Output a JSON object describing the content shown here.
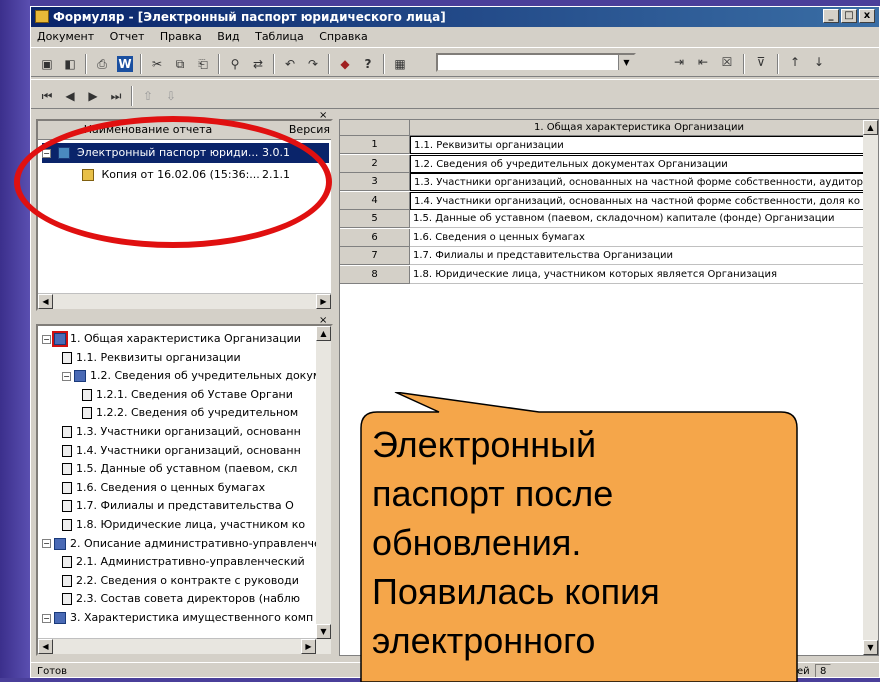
{
  "window": {
    "title": "Формуляр - [Электронный паспорт юридического лица]",
    "controls": [
      "_",
      "□",
      "x"
    ]
  },
  "menu": [
    "Документ",
    "Отчет",
    "Правка",
    "Вид",
    "Таблица",
    "Справка"
  ],
  "reports_panel": {
    "col_name": "Наименование отчета",
    "col_version": "Версия",
    "rows": [
      {
        "name": "Электронный паспорт юриди...",
        "version": "3.0.1",
        "selected": true
      },
      {
        "name": "Копия от 16.02.06 (15:36:...",
        "version": "2.1.1",
        "selected": false
      }
    ]
  },
  "grid": {
    "header": "1. Общая характеристика Организации",
    "rows": [
      {
        "num": "1",
        "text": "1.1. Реквизиты организации"
      },
      {
        "num": "2",
        "text": "1.2. Сведения об учредительных документах Организации"
      },
      {
        "num": "3",
        "text": "1.3. Участники организаций, основанных на частной форме собственности, аудитор"
      },
      {
        "num": "4",
        "text": "1.4. Участники организаций, основанных на частной форме собственности, доля ко"
      },
      {
        "num": "5",
        "text": "1.5. Данные об уставном (паевом, складочном) капитале (фонде) Организации"
      },
      {
        "num": "6",
        "text": "1.6. Сведения о ценных бумагах"
      },
      {
        "num": "7",
        "text": "1.7. Филиалы и представительства Организации"
      },
      {
        "num": "8",
        "text": "1.8. Юридические лица, участником которых является Организация"
      }
    ]
  },
  "tree": [
    {
      "label": "1. Общая характеристика Организации",
      "level": 0
    },
    {
      "label": "1.1. Реквизиты организации",
      "level": 1
    },
    {
      "label": "1.2. Сведения об учредительных докум",
      "level": 1
    },
    {
      "label": "1.2.1. Сведения об Уставе Органи",
      "level": 2
    },
    {
      "label": "1.2.2. Сведения об учредительном",
      "level": 2
    },
    {
      "label": "1.3. Участники организаций, основанн",
      "level": 1
    },
    {
      "label": "1.4. Участники организаций, основанн",
      "level": 1
    },
    {
      "label": "1.5. Данные об уставном (паевом, скл",
      "level": 1
    },
    {
      "label": "1.6. Сведения о ценных бумагах",
      "level": 1
    },
    {
      "label": "1.7. Филиалы и представительства О",
      "level": 1
    },
    {
      "label": "1.8. Юридические лица, участником ко",
      "level": 1
    },
    {
      "label": "2. Описание административно-управленче",
      "level": 0
    },
    {
      "label": "2.1. Административно-управленческий",
      "level": 1
    },
    {
      "label": "2.2. Сведения о контракте с руководи",
      "level": 1
    },
    {
      "label": "2.3. Состав совета директоров (наблю",
      "level": 1
    },
    {
      "label": "3. Характеристика имущественного комп",
      "level": 0
    }
  ],
  "status": {
    "left": "Готов",
    "right_label": "ей",
    "right_value": "8"
  },
  "callout": {
    "lines": [
      "Электронный",
      "паспорт после",
      "обновления.",
      "Появилась копия",
      "электронного"
    ]
  },
  "colors": {
    "callout_fill": "#f5a64a",
    "highlight_ellipse": "#e01010",
    "titlebar": "#0a246a",
    "selection": "#0a246a"
  }
}
